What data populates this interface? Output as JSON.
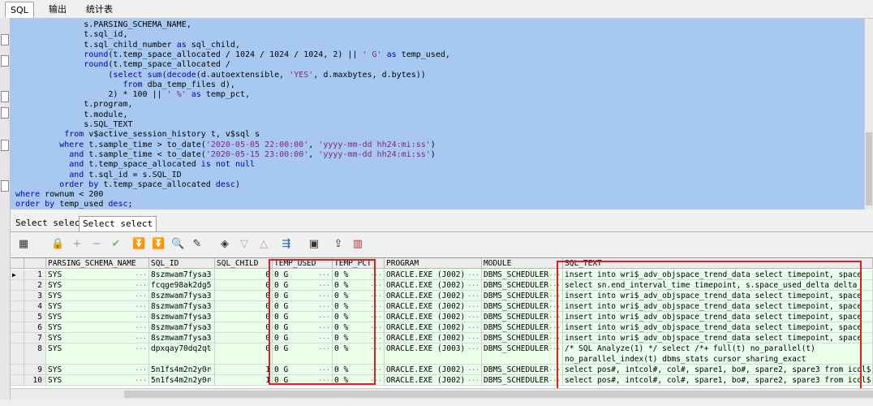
{
  "tabs": [
    "SQL",
    "输出",
    "统计表"
  ],
  "editor_lines": [
    [
      [
        "",
        "              s.PARSING_SCHEMA_NAME,"
      ]
    ],
    [
      [
        "",
        "              t.sql_id,"
      ]
    ],
    [
      [
        "",
        "              t.sql_child_number "
      ],
      [
        "kw",
        "as"
      ],
      [
        "",
        " sql_child,"
      ]
    ],
    [
      [
        "",
        "              "
      ],
      [
        "kw",
        "round"
      ],
      [
        "",
        "(t.temp_space_allocated / 1024 / 1024 / 1024, 2) || "
      ],
      [
        "str",
        "' G'"
      ],
      [
        "",
        " "
      ],
      [
        "kw",
        "as"
      ],
      [
        "",
        " temp_used,"
      ]
    ],
    [
      [
        "",
        "              "
      ],
      [
        "kw",
        "round"
      ],
      [
        "",
        "(t.temp_space_allocated /"
      ]
    ],
    [
      [
        "",
        "                   ("
      ],
      [
        "kw",
        "select sum"
      ],
      [
        "",
        "("
      ],
      [
        "kw",
        "decode"
      ],
      [
        "",
        "(d.autoextensible, "
      ],
      [
        "str",
        "'YES'"
      ],
      [
        "",
        ", d.maxbytes, d.bytes))"
      ]
    ],
    [
      [
        "",
        "                      "
      ],
      [
        "kw",
        "from"
      ],
      [
        "",
        " dba_temp_files d),"
      ]
    ],
    [
      [
        "",
        "                   2) * 100 || "
      ],
      [
        "str",
        "' %'"
      ],
      [
        "",
        " "
      ],
      [
        "kw",
        "as"
      ],
      [
        "",
        " temp_pct,"
      ]
    ],
    [
      [
        "",
        "              t.program,"
      ]
    ],
    [
      [
        "",
        "              t.module,"
      ]
    ],
    [
      [
        "",
        "              s.SQL_TEXT"
      ]
    ],
    [
      [
        "",
        "          "
      ],
      [
        "kw",
        "from"
      ],
      [
        "",
        " v$active_session_history t, v$sql s"
      ]
    ],
    [
      [
        "",
        "         "
      ],
      [
        "kw",
        "where"
      ],
      [
        "",
        " t.sample_time > to_date("
      ],
      [
        "str",
        "'2020-05-05 22:00:00'"
      ],
      [
        "",
        ", "
      ],
      [
        "str",
        "'yyyy-mm-dd hh24:mi:ss'"
      ],
      [
        "",
        ")"
      ]
    ],
    [
      [
        "",
        "           "
      ],
      [
        "kw",
        "and"
      ],
      [
        "",
        " t.sample_time < to_date("
      ],
      [
        "str",
        "'2020-05-15 23:00:00'"
      ],
      [
        "",
        ", "
      ],
      [
        "str",
        "'yyyy-mm-dd hh24:mi:ss'"
      ],
      [
        "",
        ")"
      ]
    ],
    [
      [
        "",
        "           "
      ],
      [
        "kw",
        "and"
      ],
      [
        "",
        " t.temp_space_allocated "
      ],
      [
        "kw",
        "is not null"
      ]
    ],
    [
      [
        "",
        "           "
      ],
      [
        "kw",
        "and"
      ],
      [
        "",
        " t.sql_id = s.SQL_ID"
      ]
    ],
    [
      [
        "",
        "         "
      ],
      [
        "kw",
        "order by"
      ],
      [
        "",
        " t.temp_space_allocated "
      ],
      [
        "kw",
        "desc"
      ],
      [
        "",
        ")"
      ]
    ],
    [
      [
        "kw",
        "where"
      ],
      [
        "",
        " rownum < 200"
      ]
    ],
    [
      [
        "kw",
        "order by"
      ],
      [
        "",
        " temp_used "
      ],
      [
        "kw",
        "desc"
      ],
      [
        "",
        ";"
      ]
    ]
  ],
  "result_tabs": [
    "Select select",
    "Select select"
  ],
  "toolbar_icons": [
    "grid-options-icon",
    "lock-icon",
    "add-row-icon",
    "delete-row-icon",
    "post-edit-icon",
    "fetch-next-icon",
    "fetch-all-icon",
    "find-icon",
    "clear-icon",
    "query-by-example-icon",
    "filter-down-icon",
    "filter-up-icon",
    "link-icon",
    "save-icon",
    "export-icon",
    "chart-icon"
  ],
  "columns": [
    "PARSING_SCHEMA_NAME",
    "SQL_ID",
    "SQL_CHILD",
    "TEMP_USED",
    "TEMP_PCT",
    "PROGRAM",
    "MODULE",
    "SQL_TEXT"
  ],
  "rows": [
    {
      "n": "1",
      "schema": "SYS",
      "sql_id": "8szmwam7fysa3",
      "child": "0",
      "temp_used": "0 G",
      "temp_pct": "0 %",
      "program": "ORACLE.EXE (J002)",
      "module": "DBMS_SCHEDULER",
      "sql_text": "insert into wri$_adv_objspace_trend_data select timepoint,  space"
    },
    {
      "n": "2",
      "schema": "SYS",
      "sql_id": "fcqge98ak2dg5",
      "child": "0",
      "temp_used": "0 G",
      "temp_pct": "0 %",
      "program": "ORACLE.EXE (J002)",
      "module": "DBMS_SCHEDULER",
      "sql_text": "select sn.end_interval_time timepoint, s.space_used_delta delta_"
    },
    {
      "n": "3",
      "schema": "SYS",
      "sql_id": "8szmwam7fysa3",
      "child": "0",
      "temp_used": "0 G",
      "temp_pct": "0 %",
      "program": "ORACLE.EXE (J002)",
      "module": "DBMS_SCHEDULER",
      "sql_text": "insert into wri$_adv_objspace_trend_data select timepoint,  space"
    },
    {
      "n": "4",
      "schema": "SYS",
      "sql_id": "8szmwam7fysa3",
      "child": "0",
      "temp_used": "0 G",
      "temp_pct": "0 %",
      "program": "ORACLE.EXE (J002)",
      "module": "DBMS_SCHEDULER",
      "sql_text": "insert into wri$_adv_objspace_trend_data select timepoint,  space"
    },
    {
      "n": "5",
      "schema": "SYS",
      "sql_id": "8szmwam7fysa3",
      "child": "0",
      "temp_used": "0 G",
      "temp_pct": "0 %",
      "program": "ORACLE.EXE (J002)",
      "module": "DBMS_SCHEDULER",
      "sql_text": "insert into wri$_adv_objspace_trend_data select timepoint,  space"
    },
    {
      "n": "6",
      "schema": "SYS",
      "sql_id": "8szmwam7fysa3",
      "child": "0",
      "temp_used": "0 G",
      "temp_pct": "0 %",
      "program": "ORACLE.EXE (J002)",
      "module": "DBMS_SCHEDULER",
      "sql_text": "insert into wri$_adv_objspace_trend_data select timepoint,  space"
    },
    {
      "n": "7",
      "schema": "SYS",
      "sql_id": "8szmwam7fysa3",
      "child": "0",
      "temp_used": "0 G",
      "temp_pct": "0 %",
      "program": "ORACLE.EXE (J002)",
      "module": "DBMS_SCHEDULER",
      "sql_text": "insert into wri$_adv_objspace_trend_data select timepoint,  space"
    },
    {
      "n": "8",
      "schema": "SYS",
      "sql_id": "dpxqay70dq2qt",
      "child": "0",
      "temp_used": "0 G",
      "temp_pct": "0 %",
      "program": "ORACLE.EXE (J003)",
      "module": "DBMS_SCHEDULER",
      "sql_text": "/* SQL Analyze(1) */ select /*+ full(t) no_parallel(t)",
      "sql_text2": "no_parallel_index(t) dbms_stats cursor_sharing_exact"
    },
    {
      "n": "9",
      "schema": "SYS",
      "sql_id": "5n1fs4m2n2y0r",
      "child": "1",
      "temp_used": "0 G",
      "temp_pct": "0 %",
      "program": "ORACLE.EXE (J002)",
      "module": "DBMS_SCHEDULER",
      "sql_text": "select pos#, intcol#, col#, spare1, bo#, spare2, spare3 from icol$ whe"
    },
    {
      "n": "10",
      "schema": "SYS",
      "sql_id": "5n1fs4m2n2y0r",
      "child": "1",
      "temp_used": "0 G",
      "temp_pct": "0 %",
      "program": "ORACLE.EXE (J002)",
      "module": "DBMS_SCHEDULER",
      "sql_text": "select pos#, intcol#, col#, spare1, bo#, spare2, spare3 from icol$ whe"
    }
  ]
}
